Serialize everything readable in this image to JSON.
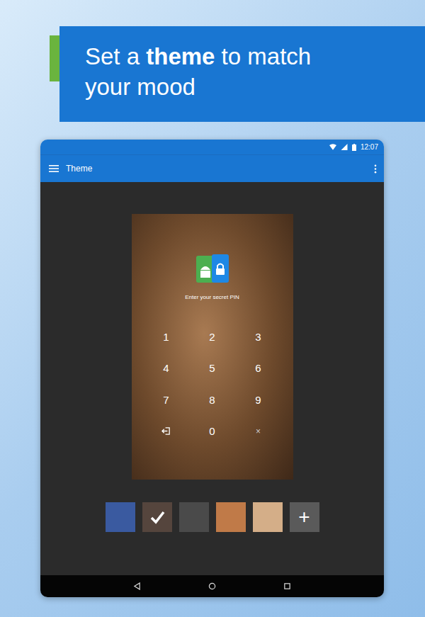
{
  "banner": {
    "text_before": "Set a ",
    "text_bold": "theme",
    "text_after": " to match your mood"
  },
  "status_bar": {
    "time": "12:07"
  },
  "toolbar": {
    "title": "Theme"
  },
  "preview": {
    "prompt": "Enter your secret PIN",
    "keys": [
      {
        "label": "1",
        "kind": "digit"
      },
      {
        "label": "2",
        "kind": "digit"
      },
      {
        "label": "3",
        "kind": "digit"
      },
      {
        "label": "4",
        "kind": "digit"
      },
      {
        "label": "5",
        "kind": "digit"
      },
      {
        "label": "6",
        "kind": "digit"
      },
      {
        "label": "7",
        "kind": "digit"
      },
      {
        "label": "8",
        "kind": "digit"
      },
      {
        "label": "9",
        "kind": "digit"
      },
      {
        "label": "",
        "kind": "exit"
      },
      {
        "label": "0",
        "kind": "digit"
      },
      {
        "label": "×",
        "kind": "clear"
      }
    ]
  },
  "themes": [
    {
      "selected": false,
      "color": "#3a5aa0"
    },
    {
      "selected": true,
      "color": "#7a6458"
    },
    {
      "selected": false,
      "color": "#4a4a4a"
    },
    {
      "selected": false,
      "color": "#c07a48"
    },
    {
      "selected": false,
      "color": "#d4ae88"
    }
  ],
  "add_button": {
    "label": "+"
  }
}
